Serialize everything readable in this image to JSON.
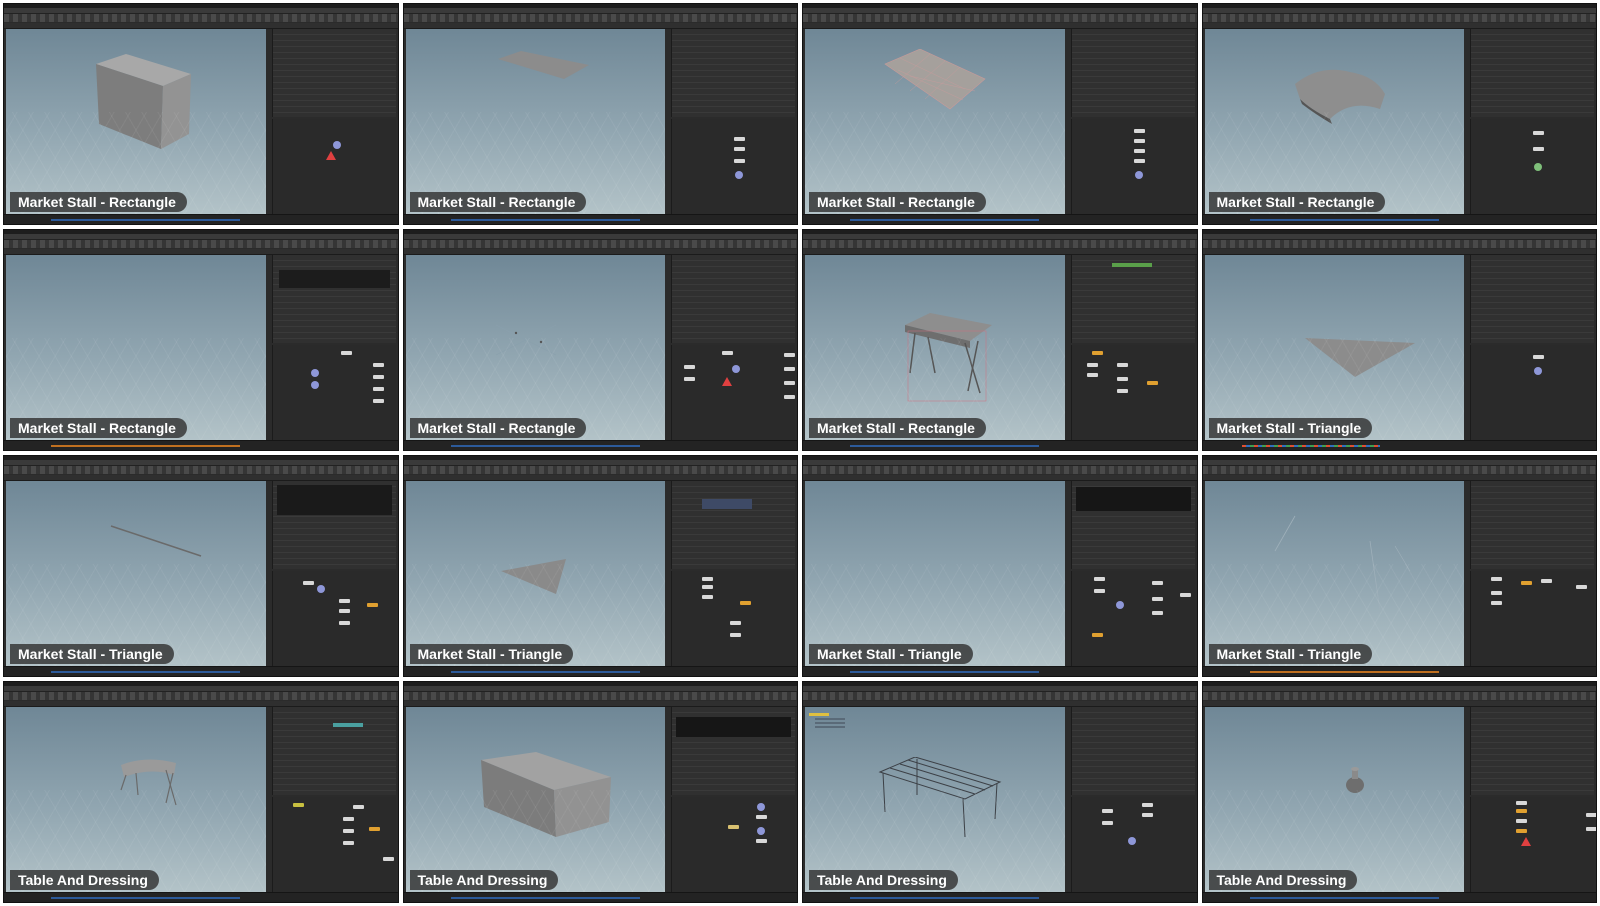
{
  "tiles": [
    {
      "label": "Market Stall - Rectangle"
    },
    {
      "label": "Market Stall - Rectangle"
    },
    {
      "label": "Market Stall - Rectangle"
    },
    {
      "label": "Market Stall - Rectangle"
    },
    {
      "label": "Market Stall - Rectangle"
    },
    {
      "label": "Market Stall - Rectangle"
    },
    {
      "label": "Market Stall - Rectangle"
    },
    {
      "label": "Market Stall - Triangle"
    },
    {
      "label": "Market Stall - Triangle"
    },
    {
      "label": "Market Stall - Triangle"
    },
    {
      "label": "Market Stall - Triangle"
    },
    {
      "label": "Market Stall - Triangle"
    },
    {
      "label": "Table And Dressing"
    },
    {
      "label": "Table And Dressing"
    },
    {
      "label": "Table And Dressing"
    },
    {
      "label": "Table And Dressing"
    }
  ],
  "colors": {
    "viewport_top": "#6f8796",
    "viewport_bottom": "#b3c3c8",
    "ui_background": "#2b2b2b",
    "geometry": "#8a8a8a",
    "node": "#d8d8d8",
    "node_accent": "#e0a030",
    "timeline": "#2c5a9a"
  }
}
